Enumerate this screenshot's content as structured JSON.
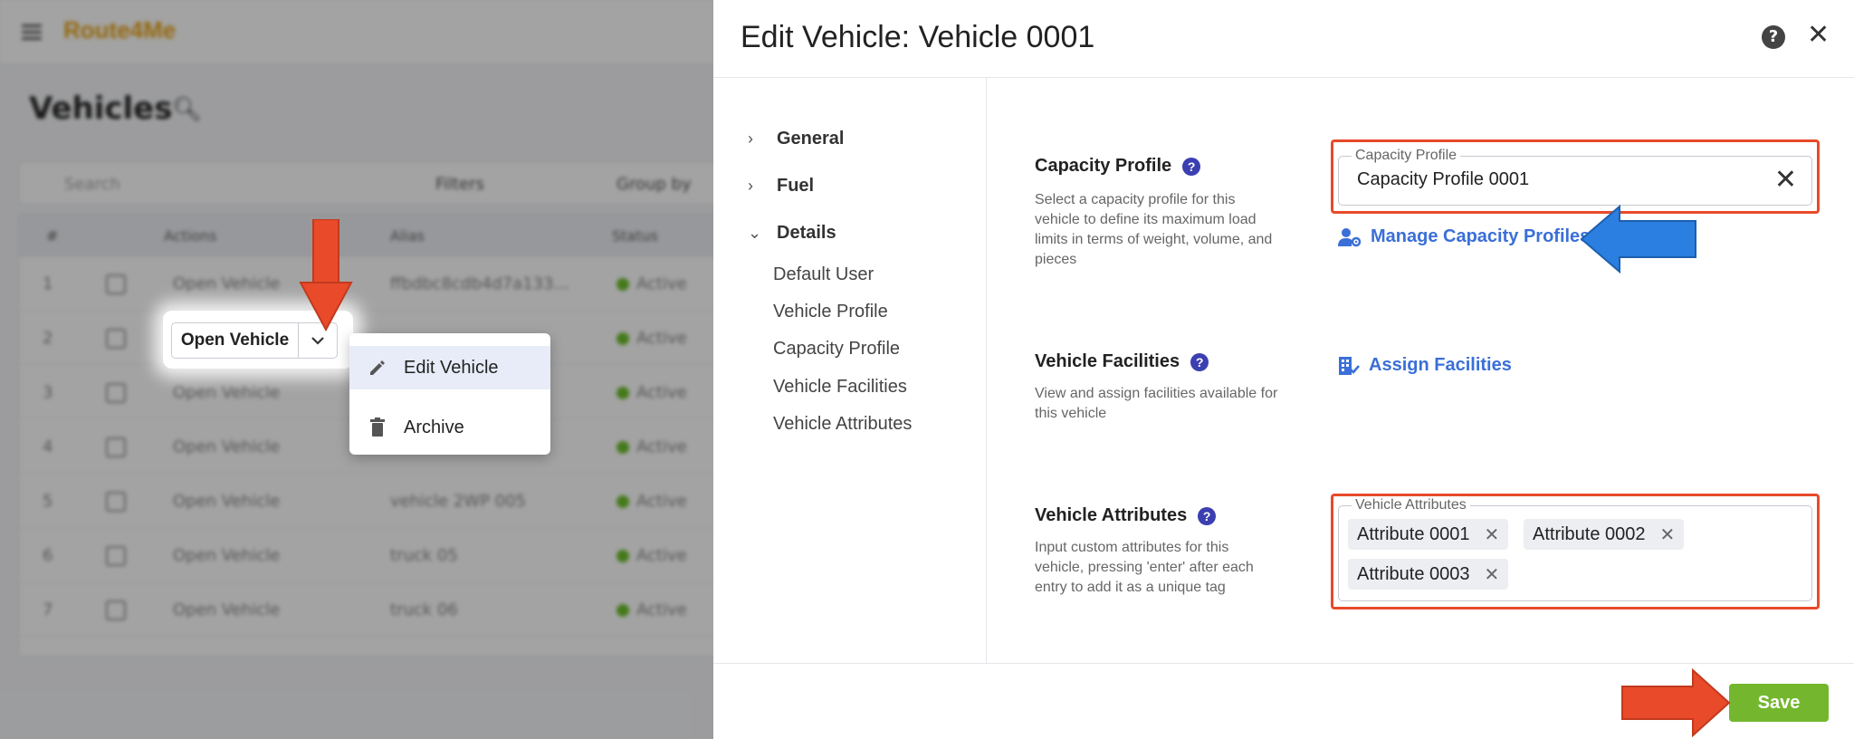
{
  "background": {
    "logo": "Route4Me",
    "page_title": "Vehicles",
    "search_placeholder": "Search",
    "filters_label": "Filters",
    "groupby_label": "Group by",
    "columns": [
      "#",
      "Actions",
      "Alias",
      "Status"
    ],
    "rows": [
      {
        "num": "1",
        "action": "Open Vehicle",
        "alias": "ffbdbc8cdb4d7a133...",
        "status": "Active"
      },
      {
        "num": "2",
        "action": "Open Vehicle",
        "alias": "",
        "status": "Active"
      },
      {
        "num": "3",
        "action": "Open Vehicle",
        "alias": "",
        "status": "Active"
      },
      {
        "num": "4",
        "action": "Open Vehicle",
        "alias": "",
        "status": "Active"
      },
      {
        "num": "5",
        "action": "Open Vehicle",
        "alias": "vehicle 2WP 005",
        "status": "Active"
      },
      {
        "num": "6",
        "action": "Open Vehicle",
        "alias": "truck 05",
        "status": "Active"
      },
      {
        "num": "7",
        "action": "Open Vehicle",
        "alias": "truck 06",
        "status": "Active"
      }
    ]
  },
  "split_button": {
    "label": "Open Vehicle"
  },
  "dropdown_menu": {
    "items": [
      {
        "label": "Edit Vehicle",
        "icon": "pencil-icon"
      },
      {
        "label": "Archive",
        "icon": "trash-icon"
      }
    ]
  },
  "drawer": {
    "title": "Edit Vehicle: Vehicle 0001",
    "nav": {
      "sections": [
        {
          "label": "General",
          "expanded": false
        },
        {
          "label": "Fuel",
          "expanded": false
        },
        {
          "label": "Details",
          "expanded": true
        }
      ],
      "sub_items": [
        "Default User",
        "Vehicle Profile",
        "Capacity Profile",
        "Vehicle Facilities",
        "Vehicle Attributes"
      ]
    },
    "capacity_profile": {
      "title": "Capacity Profile",
      "description": "Select a capacity profile for this vehicle to define its maximum load limits in terms of weight, volume, and pieces",
      "field_label": "Capacity Profile",
      "field_value": "Capacity Profile 0001",
      "manage_link": "Manage Capacity Profiles"
    },
    "vehicle_facilities": {
      "title": "Vehicle Facilities",
      "description": "View and assign facilities available for this vehicle",
      "assign_link": "Assign Facilities"
    },
    "vehicle_attributes": {
      "title": "Vehicle Attributes",
      "description": "Input custom attributes for this vehicle, pressing 'enter' after each entry to add it as a unique tag",
      "field_label": "Vehicle Attributes",
      "chips": [
        "Attribute 0001",
        "Attribute 0002",
        "Attribute 0003"
      ]
    },
    "save_label": "Save"
  },
  "colors": {
    "highlight_red": "#e84a2a",
    "arrow_blue": "#2a7fe0",
    "link_blue": "#3a6fd8",
    "save_green": "#74b72e",
    "help_purple": "#3b3fb0"
  }
}
